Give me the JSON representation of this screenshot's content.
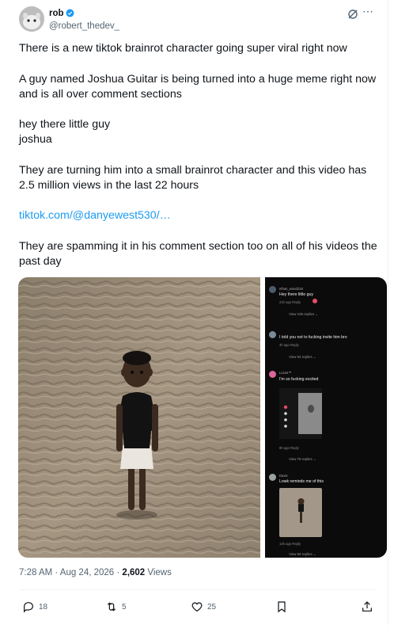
{
  "author": {
    "name": "rob",
    "handle": "@robert_thedev_"
  },
  "paragraphs": [
    "There is a new tiktok brainrot character going super viral right now",
    "A guy named Joshua Guitar is being turned into a huge meme right now and is all over comment sections",
    "hey there little guy\njoshua",
    "They are turning him into a small brainrot character and this video has 2.5 million views in the last 22 hours",
    "tiktok.com/@danyewest530/…",
    "They are spamming it in his comment section too on all of his videos the past day"
  ],
  "comments": [
    {
      "user": "ethan_wood218",
      "text": "Hey there little guy",
      "meta": "21h ago   Reply",
      "replies": "View 105 replies ⌄"
    },
    {
      "user": "",
      "text": "I told you not to fucking invite him bro",
      "meta": "4h ago   Reply",
      "replies": "View 64 replies ⌄"
    },
    {
      "user": "Lucas™",
      "text": "I'm so fucking excited",
      "meta": "8h ago   Reply",
      "replies": "View 78 replies ⌄"
    },
    {
      "user": "Davis",
      "text": "Lowk reminds me of this",
      "meta": "14h ago   Reply",
      "replies": "View 66 replies ⌄"
    }
  ],
  "timestamp": {
    "time": "7:28 AM · Aug 24, 2026 · ",
    "views_count": "2,602",
    "views_label": " Views"
  },
  "actions": {
    "replies": "18",
    "reposts": "5",
    "likes": "25"
  },
  "colors": {
    "link": "#1d9bf0",
    "verified": "#1d9bf0",
    "secondary": "#536471"
  }
}
